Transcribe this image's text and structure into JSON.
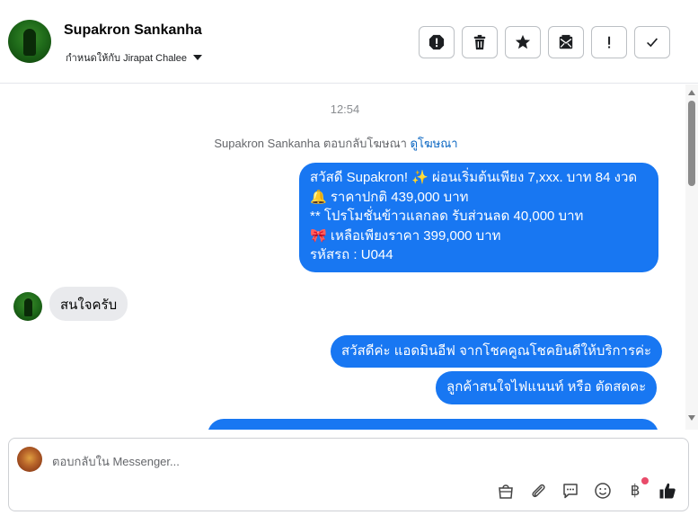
{
  "header": {
    "contact_name": "Supakron Sankanha",
    "assigned_to": "กำหนดให้กับ Jirapat Chalee"
  },
  "chat": {
    "timestamp": "12:54",
    "reply_note": "Supakron Sankanha ตอบกลับโฆษณา",
    "reply_note_link": "ดูโฆษณา",
    "promo_lines": [
      "สวัสดี Supakron! ✨  ผ่อนเริ่มต้นเพียง 7,xxx. บาท 84 งวด",
      "🔔 ราคาปกติ 439,000 บาท",
      "** โปรโมชั่นข้าวแลกลด รับส่วนลด 40,000 บาท",
      "🎀  เหลือเพียงราคา 399,000 บาท",
      " รหัสรถ : U044"
    ],
    "incoming_message": "สนใจครับ",
    "outgoing_1": "สวัสดีค่ะ แอดมินอีฟ จากโชคคูณโชคยินดีให้บริการค่ะ",
    "outgoing_2": "ลูกค้าสนใจไฟแนนท์ หรือ ตัดสดคะ"
  },
  "composer": {
    "placeholder": "ตอบกลับใน Messenger...",
    "currency_symbol": "฿"
  },
  "colors": {
    "accent": "#1877f2",
    "incoming_bubble": "#e9eaed",
    "notification_dot": "#e94b6a"
  },
  "icons": {
    "header_actions": [
      "spam-icon",
      "trash-icon",
      "star-icon",
      "mark-unread-icon",
      "important-icon",
      "done-check-icon"
    ],
    "composer_tools": [
      "shopping-bag-icon",
      "attachment-icon",
      "saved-replies-icon",
      "emoji-icon",
      "baht-payment-icon",
      "like-icon"
    ]
  }
}
